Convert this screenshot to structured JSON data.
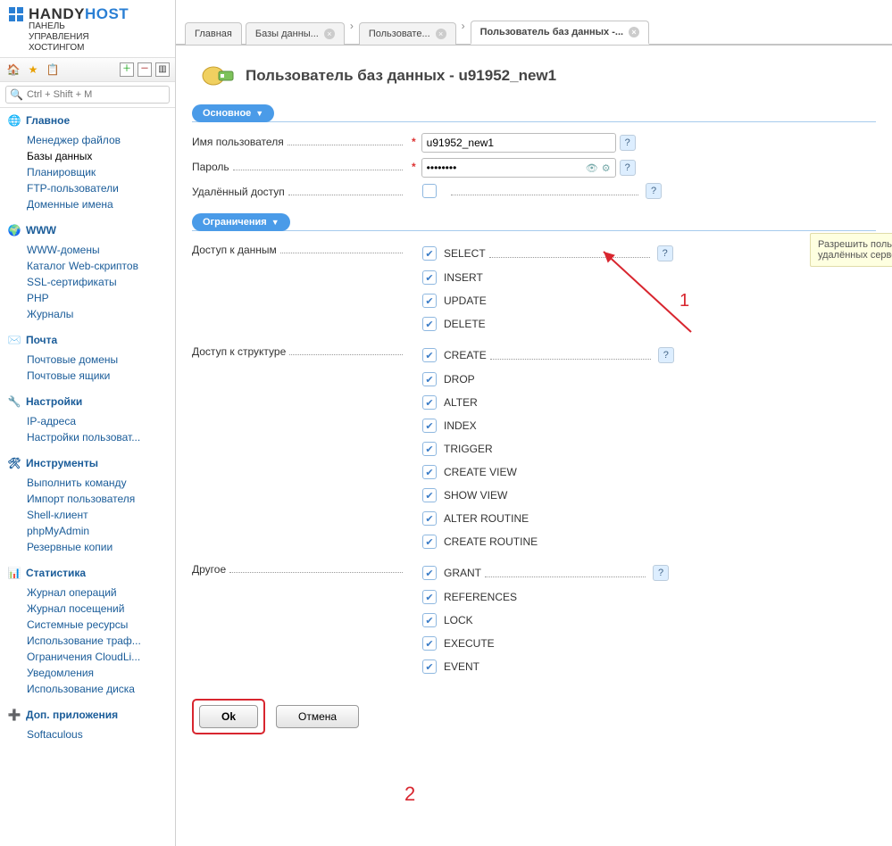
{
  "logo": {
    "name_part1": "HANDY",
    "name_part2": "HOST",
    "subtitle_l1": "ПАНЕЛЬ",
    "subtitle_l2": "УПРАВЛЕНИЯ",
    "subtitle_l3": "ХОСТИНГОМ"
  },
  "search": {
    "placeholder": "Ctrl + Shift + M"
  },
  "nav": {
    "main": {
      "title": "Главное",
      "items": [
        "Менеджер файлов",
        "Базы данных",
        "Планировщик",
        "FTP-пользователи",
        "Доменные имена"
      ],
      "activeIndex": 1
    },
    "www": {
      "title": "WWW",
      "items": [
        "WWW-домены",
        "Каталог Web-скриптов",
        "SSL-сертификаты",
        "PHP",
        "Журналы"
      ]
    },
    "mail": {
      "title": "Почта",
      "items": [
        "Почтовые домены",
        "Почтовые ящики"
      ]
    },
    "settings": {
      "title": "Настройки",
      "items": [
        "IP-адреса",
        "Настройки пользоват..."
      ]
    },
    "tools": {
      "title": "Инструменты",
      "items": [
        "Выполнить команду",
        "Импорт пользователя",
        "Shell-клиент",
        "phpMyAdmin",
        "Резервные копии"
      ]
    },
    "stats": {
      "title": "Статистика",
      "items": [
        "Журнал операций",
        "Журнал посещений",
        "Системные ресурсы",
        "Использование траф...",
        "Ограничения CloudLi...",
        "Уведомления",
        "Использование диска"
      ]
    },
    "addons": {
      "title": "Доп. приложения",
      "items": [
        "Softaculous"
      ]
    }
  },
  "tabs": {
    "t0": "Главная",
    "t1": "Базы данны...",
    "t2": "Пользовате...",
    "t3": "Пользователь баз данных -..."
  },
  "page": {
    "title": "Пользователь баз данных - u91952_new1"
  },
  "sections": {
    "basic": "Основное",
    "limits": "Ограничения"
  },
  "form": {
    "username_label": "Имя пользователя",
    "username_value": "u91952_new1",
    "password_label": "Пароль",
    "password_value": "••••••••",
    "remote_label": "Удалённый доступ"
  },
  "tooltip": "Разрешить пользователю баз данных доступ с удалённых серверов",
  "perm_groups": {
    "data": {
      "label": "Доступ к данным",
      "items": [
        "SELECT",
        "INSERT",
        "UPDATE",
        "DELETE"
      ]
    },
    "struct": {
      "label": "Доступ к структуре",
      "items": [
        "CREATE",
        "DROP",
        "ALTER",
        "INDEX",
        "TRIGGER",
        "CREATE VIEW",
        "SHOW VIEW",
        "ALTER ROUTINE",
        "CREATE ROUTINE"
      ]
    },
    "other": {
      "label": "Другое",
      "items": [
        "GRANT",
        "REFERENCES",
        "LOCK",
        "EXECUTE",
        "EVENT"
      ]
    }
  },
  "buttons": {
    "ok": "Ok",
    "cancel": "Отмена"
  },
  "annotations": {
    "a1": "1",
    "a2": "2"
  }
}
